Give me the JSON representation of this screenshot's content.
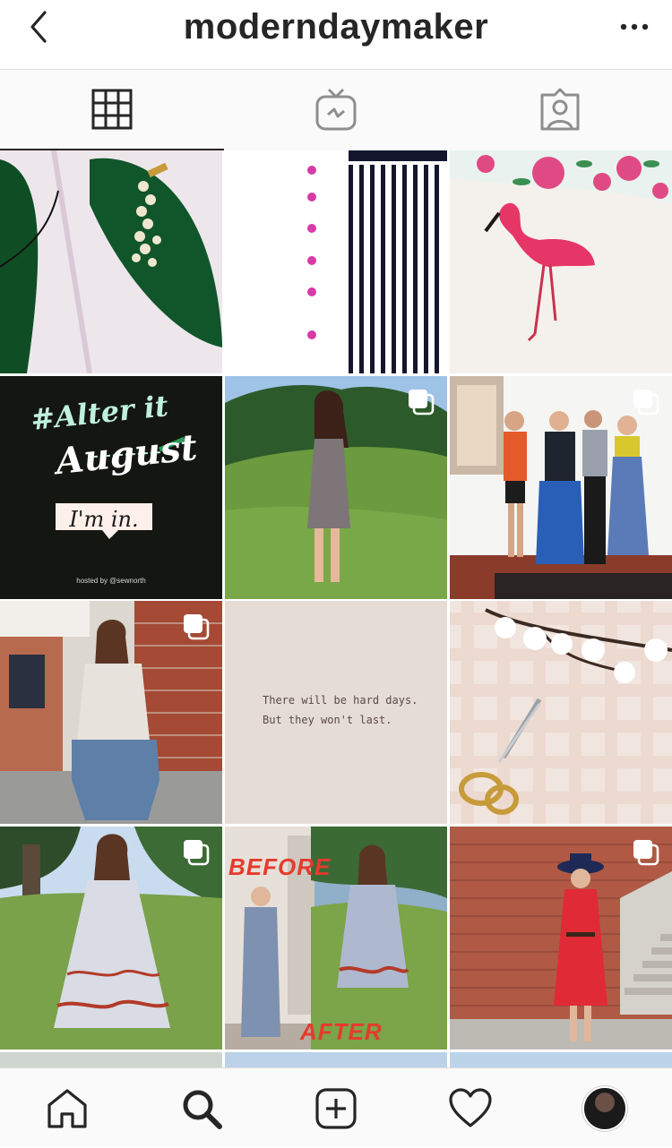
{
  "header": {
    "username": "moderndaymaker",
    "back_icon": "chevron-left-icon",
    "more_icon": "ellipsis-icon"
  },
  "tabs": [
    {
      "name": "grid",
      "icon": "grid-icon",
      "active": true
    },
    {
      "name": "igtv",
      "icon": "igtv-icon",
      "active": false
    },
    {
      "name": "tagged",
      "icon": "tagged-person-icon",
      "active": false
    }
  ],
  "posts": {
    "alter_tile": {
      "line1": "#Alter it",
      "line2": "August",
      "bubble": "I'm in.",
      "hosted_by": "hosted by @sewnorth"
    },
    "quote_tile": {
      "line1": "There will be hard days.",
      "line2": "But they won't last."
    },
    "before_after": {
      "before": "BEFORE",
      "after": "AFTER"
    }
  },
  "bottom_nav": [
    {
      "name": "home",
      "icon": "home-icon"
    },
    {
      "name": "search",
      "icon": "search-icon",
      "active": true
    },
    {
      "name": "new-post",
      "icon": "plus-square-icon"
    },
    {
      "name": "activity",
      "icon": "heart-icon"
    },
    {
      "name": "profile",
      "icon": "profile-avatar"
    }
  ],
  "colors": {
    "text": "#262626",
    "divider": "#dbdbdb",
    "bar_bg": "#fafafa",
    "accent_green": "#0f5a2a",
    "mint": "#bff0dc"
  }
}
